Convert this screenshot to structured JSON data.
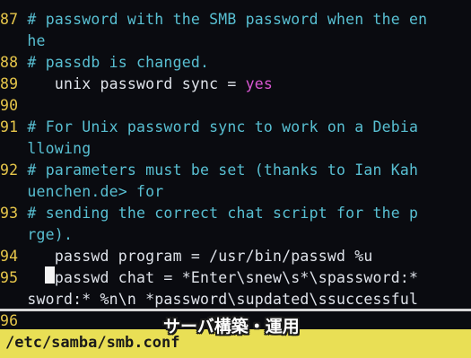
{
  "editor": {
    "lines": [
      {
        "ln": "87",
        "text": "# password with the SMB password when the en"
      },
      {
        "ln": "",
        "text": "he"
      },
      {
        "ln": "88",
        "text": "# passdb is changed."
      },
      {
        "ln": "89",
        "code": "   unix password sync = ",
        "kw": "yes"
      },
      {
        "ln": "90",
        "text": ""
      },
      {
        "ln": "91",
        "text": "# For Unix password sync to work on a Debia"
      },
      {
        "ln": "",
        "text": "llowing"
      },
      {
        "ln": "92",
        "text": "# parameters must be set (thanks to Ian Kah"
      },
      {
        "ln": "",
        "text": "uenchen.de> for"
      },
      {
        "ln": "93",
        "text": "# sending the correct chat script for the p"
      },
      {
        "ln": "",
        "text": "rge)."
      },
      {
        "ln": "94",
        "code": "   passwd program = /usr/bin/passwd %u"
      },
      {
        "ln": "95",
        "code": "   passwd chat = *Enter\\snew\\s*\\spassword:*"
      },
      {
        "ln": "",
        "code": "sword:* %n\\n *password\\supdated\\ssuccessful"
      },
      {
        "ln": "96",
        "text": ""
      }
    ]
  },
  "status": {
    "filename": "/etc/samba/smb.conf"
  },
  "caption": "サーバ構築・運用"
}
